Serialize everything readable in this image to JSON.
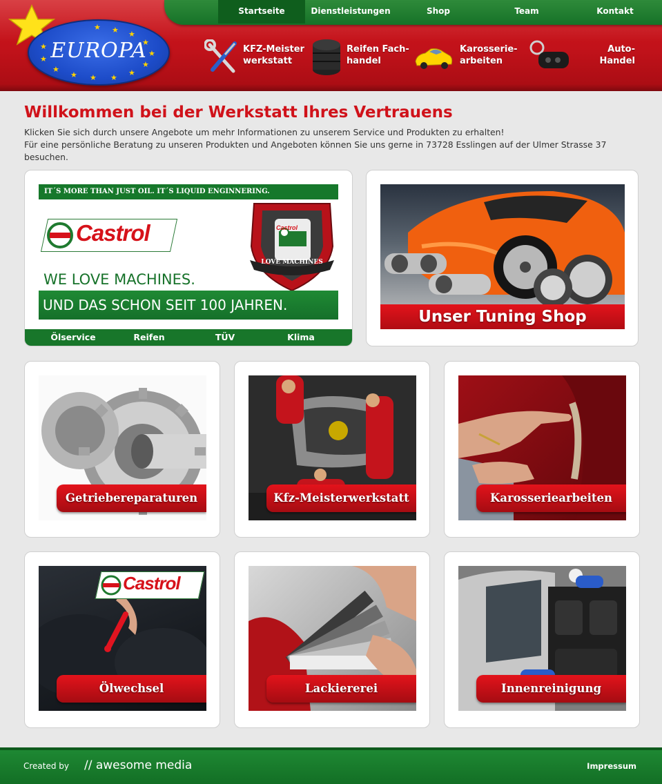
{
  "logo": {
    "text": "EUROPA"
  },
  "nav": {
    "items": [
      {
        "label": "Startseite",
        "active": true
      },
      {
        "label": "Dienstleistungen"
      },
      {
        "label": "Shop"
      },
      {
        "label": "Team"
      },
      {
        "label": "Kontakt"
      }
    ]
  },
  "services": [
    {
      "line1": "KFZ-Meister",
      "line2": "werkstatt",
      "icon": "wrench-screwdriver-icon"
    },
    {
      "line1": "Reifen Fach-",
      "line2": "handel",
      "icon": "tire-stack-icon"
    },
    {
      "line1": "Karosserie-",
      "line2": "arbeiten",
      "icon": "yellow-car-icon"
    },
    {
      "line1": "Auto-",
      "line2": "Handel",
      "icon": "car-key-icon"
    }
  ],
  "intro": {
    "title": "Willkommen bei der Werkstatt Ihres Vertrauens",
    "line1": "Klicken Sie sich durch unsere Angebote um mehr Informationen zu unserem Service und Produkten zu erhalten!",
    "line2": "Für eine persönliche Beratung zu unseren Produkten und Angeboten können Sie uns gerne in 73728 Esslingen auf der Ulmer Strasse 37",
    "line3": "besuchen."
  },
  "castrol": {
    "tagline": "IT´S MORE THAN JUST OIL. IT´S LIQUID ENGINNERING.",
    "brand": "Castrol",
    "slogan1": "WE LOVE MACHINES.",
    "slogan2": "UND DAS SCHON SEIT 100 JAHREN.",
    "badge": "LOVE MACHINES",
    "bottle": "Castrol",
    "links": [
      "Ölservice",
      "Reifen",
      "TÜV",
      "Klima"
    ]
  },
  "tuning": {
    "caption": "Unser Tuning Shop"
  },
  "tiles": [
    {
      "caption": "Getriebereparaturen",
      "image": "gears"
    },
    {
      "caption": "Kfz-Meisterwerkstatt",
      "image": "mechanics"
    },
    {
      "caption": "Karosseriearbeiten",
      "image": "paint-damage"
    },
    {
      "caption": "Ölwechsel",
      "image": "oil-dipstick",
      "brand": "Castrol"
    },
    {
      "caption": "Lackiererei",
      "image": "color-fan"
    },
    {
      "caption": "Innenreinigung",
      "image": "car-interior"
    }
  ],
  "footer": {
    "created_by": "Created by",
    "brand": "// awesome media",
    "impressum": "Impressum"
  },
  "colors": {
    "red": "#d0121a",
    "green": "#18762a",
    "background": "#e8e8e8"
  }
}
